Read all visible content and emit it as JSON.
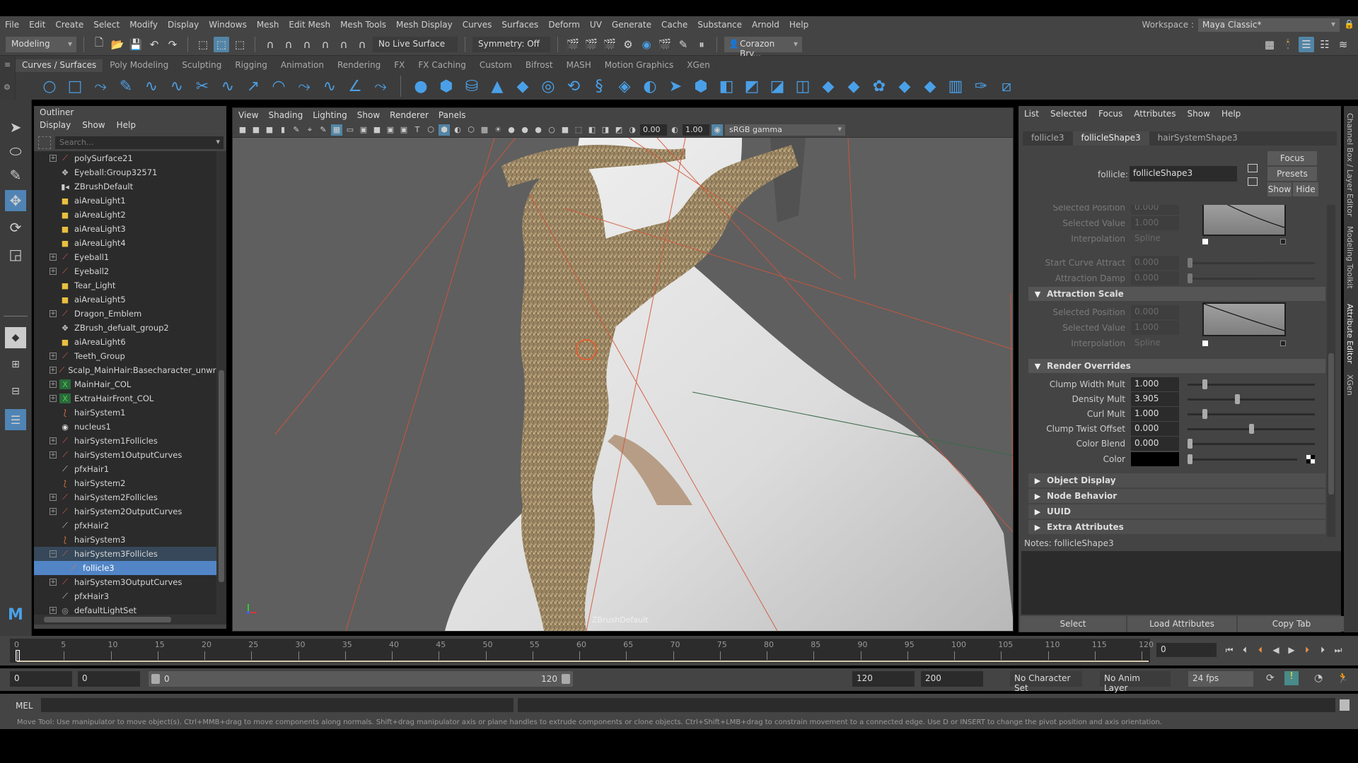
{
  "menubar": {
    "items": [
      "File",
      "Edit",
      "Create",
      "Select",
      "Modify",
      "Display",
      "Windows",
      "Mesh",
      "Edit Mesh",
      "Mesh Tools",
      "Mesh Display",
      "Curves",
      "Surfaces",
      "Deform",
      "UV",
      "Generate",
      "Cache",
      "Substance",
      "Arnold",
      "Help"
    ],
    "workspace_label": "Workspace :",
    "workspace_value": "Maya Classic*"
  },
  "statusline": {
    "menuset": "Modeling",
    "live_surface": "No Live Surface",
    "symmetry": "Symmetry: Off",
    "user": "Corazon Bry..."
  },
  "shelf": {
    "tabs": [
      "Curves / Surfaces",
      "Poly Modeling",
      "Sculpting",
      "Rigging",
      "Animation",
      "Rendering",
      "FX",
      "FX Caching",
      "Custom",
      "Bifrost",
      "MASH",
      "Motion Graphics",
      "XGen"
    ],
    "active_tab": "Curves / Surfaces"
  },
  "outliner": {
    "title": "Outliner",
    "menus": [
      "Display",
      "Show",
      "Help"
    ],
    "search_placeholder": "Search...",
    "items": [
      {
        "label": "polySurface21",
        "icon": "transform-icon",
        "expandable": true
      },
      {
        "label": "Eyeball:Group32571",
        "icon": "group-icon",
        "expandable": false
      },
      {
        "label": "ZBrushDefault",
        "icon": "camera-icon",
        "expandable": false
      },
      {
        "label": "aiAreaLight1",
        "icon": "light-icon",
        "expandable": false
      },
      {
        "label": "aiAreaLight2",
        "icon": "light-icon",
        "expandable": false
      },
      {
        "label": "aiAreaLight3",
        "icon": "light-icon",
        "expandable": false
      },
      {
        "label": "aiAreaLight4",
        "icon": "light-icon",
        "expandable": false
      },
      {
        "label": "Eyeball1",
        "icon": "transform-icon",
        "expandable": true
      },
      {
        "label": "Eyeball2",
        "icon": "transform-icon",
        "expandable": true
      },
      {
        "label": "Tear_Light",
        "icon": "light-icon",
        "expandable": false
      },
      {
        "label": "aiAreaLight5",
        "icon": "light-icon",
        "expandable": false
      },
      {
        "label": "Dragon_Emblem",
        "icon": "transform-icon",
        "expandable": true
      },
      {
        "label": "ZBrush_defualt_group2",
        "icon": "group-icon",
        "expandable": false
      },
      {
        "label": "aiAreaLight6",
        "icon": "light-icon",
        "expandable": false
      },
      {
        "label": "Teeth_Group",
        "icon": "transform-icon",
        "expandable": true
      },
      {
        "label": "Scalp_MainHair:Basecharacter_unwrapp",
        "icon": "transform-icon",
        "expandable": true
      },
      {
        "label": "MainHair_COL",
        "icon": "collider-icon",
        "expandable": true
      },
      {
        "label": "ExtraHairFront_COL",
        "icon": "collider-icon",
        "expandable": true
      },
      {
        "label": "hairSystem1",
        "icon": "hair-system-icon",
        "expandable": false
      },
      {
        "label": "nucleus1",
        "icon": "nucleus-icon",
        "expandable": false
      },
      {
        "label": "hairSystem1Follicles",
        "icon": "transform-icon",
        "expandable": true
      },
      {
        "label": "hairSystem1OutputCurves",
        "icon": "transform-icon",
        "expandable": true
      },
      {
        "label": "pfxHair1",
        "icon": "pfx-hair-icon",
        "expandable": false
      },
      {
        "label": "hairSystem2",
        "icon": "hair-system-icon",
        "expandable": false
      },
      {
        "label": "hairSystem2Follicles",
        "icon": "transform-icon",
        "expandable": true
      },
      {
        "label": "hairSystem2OutputCurves",
        "icon": "transform-icon",
        "expandable": true
      },
      {
        "label": "pfxHair2",
        "icon": "pfx-hair-icon",
        "expandable": false
      },
      {
        "label": "hairSystem3",
        "icon": "hair-system-icon",
        "expandable": false
      },
      {
        "label": "hairSystem3Follicles",
        "icon": "transform-icon",
        "expandable": true,
        "expanded": true,
        "state": "parent-selected"
      },
      {
        "label": "follicle3",
        "icon": "follicle-icon",
        "expandable": false,
        "child": true,
        "state": "selected"
      },
      {
        "label": "hairSystem3OutputCurves",
        "icon": "transform-icon",
        "expandable": true
      },
      {
        "label": "pfxHair3",
        "icon": "pfx-hair-icon",
        "expandable": false
      },
      {
        "label": "defaultLightSet",
        "icon": "set-icon",
        "expandable": true
      }
    ]
  },
  "viewport": {
    "menus": [
      "View",
      "Shading",
      "Lighting",
      "Show",
      "Renderer",
      "Panels"
    ],
    "exposure": "0.00",
    "gamma": "1.00",
    "color_space": "sRGB gamma",
    "camera_label": "ZBrushDefault"
  },
  "attribute_editor": {
    "menus": [
      "List",
      "Selected",
      "Focus",
      "Attributes",
      "Show",
      "Help"
    ],
    "tabs": [
      "follicle3",
      "follicleShape3",
      "hairSystemShape3"
    ],
    "active_tab": "follicleShape3",
    "node_type_label": "follicle:",
    "node_name": "follicleShape3",
    "buttons": {
      "focus": "Focus",
      "presets": "Presets",
      "show": "Show",
      "hide": "Hide"
    },
    "upper_ramp": {
      "selected_position_label": "Selected Position",
      "selected_position": "0.000",
      "selected_value_label": "Selected Value",
      "selected_value": "1.000",
      "interpolation_label": "Interpolation",
      "interpolation": "Spline"
    },
    "start_curve_attract_label": "Start Curve Attract",
    "start_curve_attract": "0.000",
    "attraction_damp_label": "Attraction Damp",
    "attraction_damp": "0.000",
    "attraction_scale": {
      "title": "Attraction Scale",
      "selected_position_label": "Selected Position",
      "selected_position": "0.000",
      "selected_value_label": "Selected Value",
      "selected_value": "1.000",
      "interpolation_label": "Interpolation",
      "interpolation": "Spline"
    },
    "render_overrides": {
      "title": "Render Overrides",
      "rows": [
        {
          "label": "Clump Width Mult",
          "value": "1.000",
          "slider_fraction": 0.12
        },
        {
          "label": "Density Mult",
          "value": "3.905",
          "slider_fraction": 0.39
        },
        {
          "label": "Curl Mult",
          "value": "1.000",
          "slider_fraction": 0.12
        },
        {
          "label": "Clump Twist Offset",
          "value": "0.000",
          "slider_fraction": 0.5
        },
        {
          "label": "Color Blend",
          "value": "0.000",
          "slider_fraction": 0.0
        }
      ],
      "color_label": "Color",
      "color_value": "#000000"
    },
    "collapsed_sections": [
      "Object Display",
      "Node Behavior",
      "UUID",
      "Extra Attributes"
    ],
    "notes_label": "Notes:",
    "notes_node": "follicleShape3",
    "bottom_buttons": [
      "Select",
      "Load Attributes",
      "Copy Tab"
    ]
  },
  "side_tabs": [
    "Channel Box / Layer Editor",
    "Modeling Toolkit",
    "Attribute Editor",
    "XGen"
  ],
  "timeline": {
    "ticks": [
      0,
      5,
      10,
      15,
      20,
      25,
      30,
      35,
      40,
      45,
      50,
      55,
      60,
      65,
      70,
      75,
      80,
      85,
      90,
      95,
      100,
      105,
      110,
      115,
      120
    ],
    "current_frame": "0",
    "current_frame_field": "0"
  },
  "range": {
    "start_time": "0",
    "playback_start": "0",
    "range_start_label": "0",
    "range_end_label": "120",
    "playback_end": "120",
    "end_time": "200",
    "character_set": "No Character Set",
    "anim_layer": "No Anim Layer",
    "fps": "24 fps"
  },
  "command_line": {
    "label": "MEL"
  },
  "help_line": "Move Tool: Use manipulator to move object(s). Ctrl+MMB+drag to move components along normals. Shift+drag manipulator axis or plane handles to extrude components or clone objects. Ctrl+Shift+LMB+drag to constrain movement to a connected edge. Use D or INSERT to change the pivot position and axis orientation."
}
